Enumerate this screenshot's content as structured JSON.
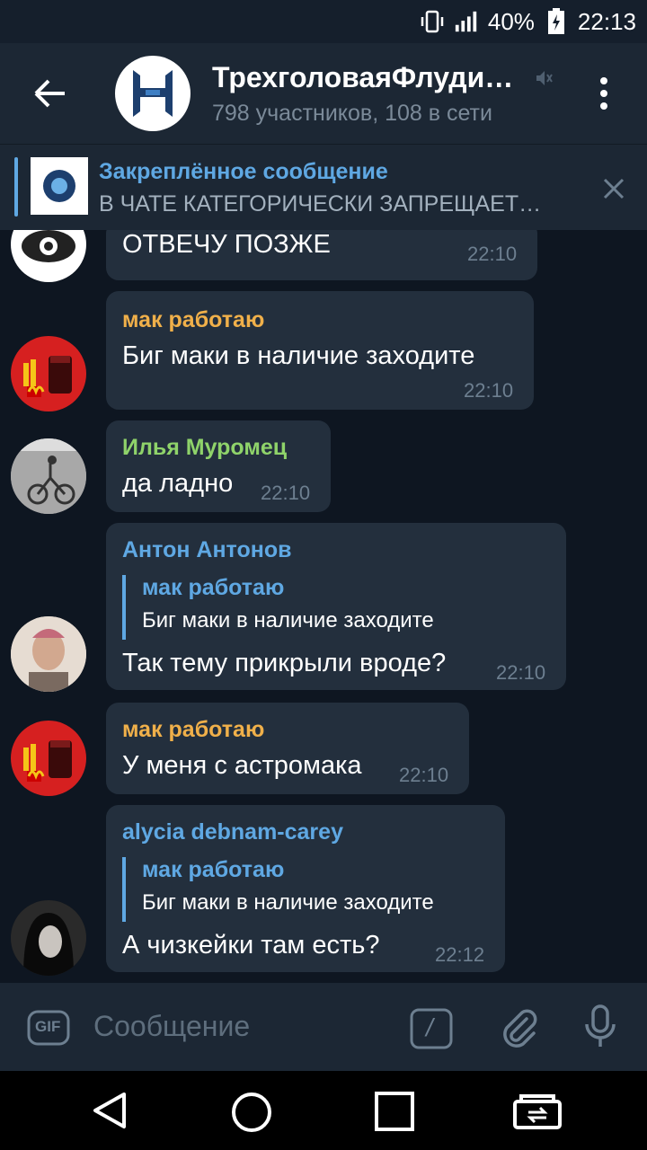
{
  "status": {
    "battery": "40%",
    "time": "22:13"
  },
  "header": {
    "title": "ТрехголоваяФлуди…",
    "subtitle": "798 участников, 108 в сети"
  },
  "pinned": {
    "title": "Закреплённое сообщение",
    "text": "В ЧАТЕ КАТЕГОРИЧЕСКИ ЗАПРЕЩАЕТ…"
  },
  "colors": {
    "accent": "#5fa8e3",
    "name_orange": "#f0b04a",
    "name_green": "#8fd36a",
    "bubble": "#232f3d",
    "background": "#0e1621"
  },
  "messages": [
    {
      "text": "ОТВЕЧУ ПОЗЖЕ",
      "time": "22:10"
    },
    {
      "name": "мак работаю",
      "text": "Биг маки в наличие заходите",
      "time": "22:10"
    },
    {
      "name": "Илья Муромец",
      "text": "да ладно",
      "time": "22:10"
    },
    {
      "name": "Антон Антонов",
      "reply_name": "мак работаю",
      "reply_text": "Биг маки в наличие заходите",
      "text": "Так тему прикрыли вроде?",
      "time": "22:10"
    },
    {
      "name": "мак работаю",
      "text": "У меня с астромака",
      "time": "22:10"
    },
    {
      "name": "alycia debnam-carey",
      "reply_name": "мак работаю",
      "reply_text": "Биг маки в наличие заходите",
      "text": "А чизкейки  там есть?",
      "time": "22:12"
    }
  ],
  "input": {
    "gif_label": "GIF",
    "placeholder": "Сообщение",
    "command_label": "/"
  }
}
